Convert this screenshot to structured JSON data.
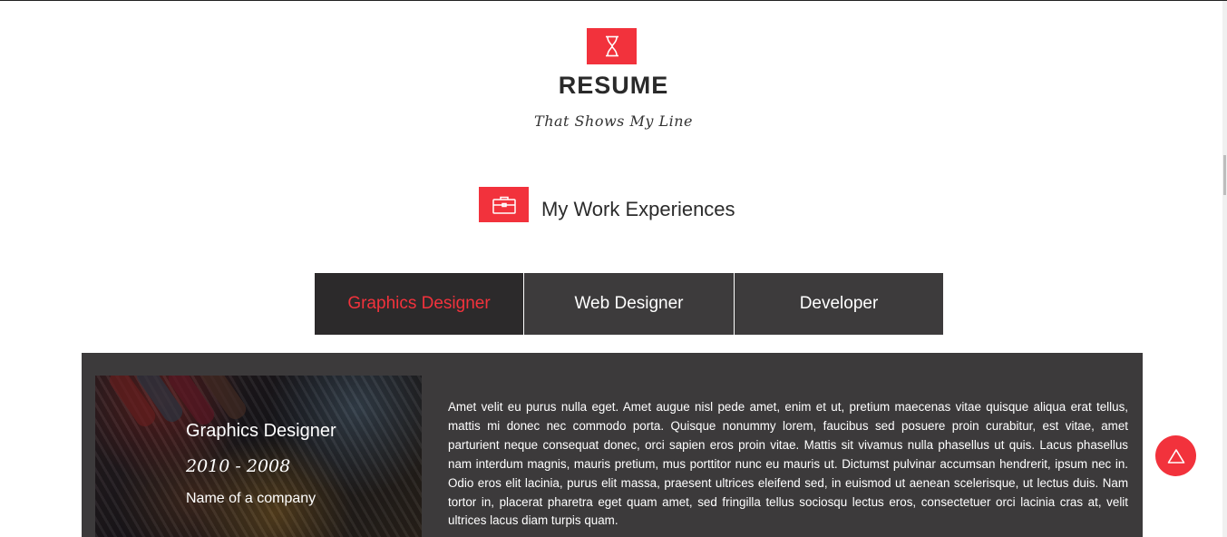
{
  "header": {
    "title": "RESUME",
    "subtitle": "That Shows My Line"
  },
  "section": {
    "heading": "My Work Experiences"
  },
  "tabs": [
    {
      "label": "Graphics Designer",
      "active": true
    },
    {
      "label": "Web Designer",
      "active": false
    },
    {
      "label": "Developer",
      "active": false
    }
  ],
  "experience": {
    "job_title": "Graphics Designer",
    "years": "2010 - 2008",
    "company": "Name of a company",
    "description": "Amet velit eu purus nulla eget. Amet augue nisl pede amet, enim et ut, pretium maecenas vitae quisque aliqua erat tellus, mattis mi donec nec commodo porta. Quisque nonummy lorem, faucibus sed posuere proin curabitur, est vitae, amet parturient neque consequat donec, orci sapien eros proin vitae. Mattis sit vivamus nulla phasellus ut quis. Lacus phasellus nam interdum magnis, mauris pretium, mus porttitor nunc eu mauris ut. Dictumst pulvinar accumsan hendrerit, ipsum nec in. Odio eros elit lacinia, purus elit massa, praesent ultrices eleifend sed, in euismod ut aenean scelerisque, ut lectus duis. Nam tortor in, placerat pharetra eget quam amet, sed fringilla tellus sociosqu lectus eros, consectetuer orci lacinia cras at, velit ultrices lacus diam turpis quam."
  },
  "icons": {
    "header": "hourglass-icon",
    "section": "briefcase-icon",
    "scroll_top": "triangle-up-icon"
  },
  "colors": {
    "accent": "#f2323c",
    "tab_bg": "#3d3b3c",
    "tab_active_bg": "#2c2a2b",
    "panel_bg": "#3c3a3b"
  }
}
